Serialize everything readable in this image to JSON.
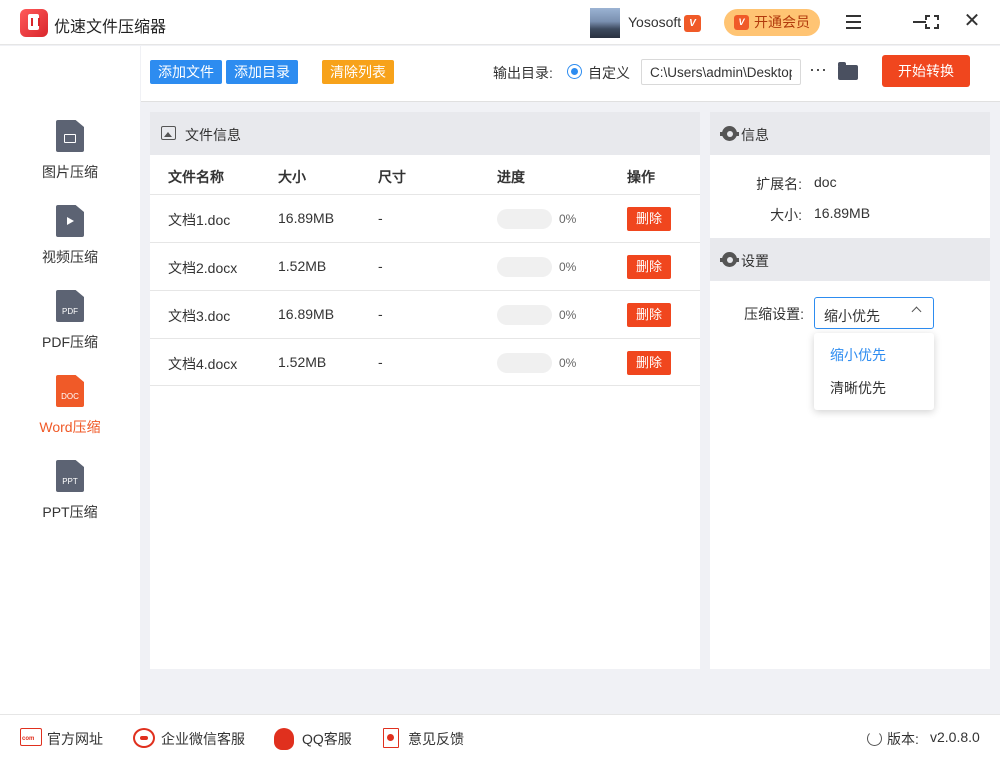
{
  "app": {
    "title": "优速文件压缩器",
    "username": "Yososoft",
    "user_badge": "V",
    "vip_button": "开通会员",
    "vip_icon": "V"
  },
  "sidebar": {
    "items": [
      {
        "label": "图片压缩",
        "icon": "image-file-icon",
        "icon_text": ""
      },
      {
        "label": "视频压缩",
        "icon": "video-file-icon",
        "icon_text": ""
      },
      {
        "label": "PDF压缩",
        "icon": "pdf-file-icon",
        "icon_text": "PDF"
      },
      {
        "label": "Word压缩",
        "icon": "doc-file-icon",
        "icon_text": "DOC",
        "active": true
      },
      {
        "label": "PPT压缩",
        "icon": "ppt-file-icon",
        "icon_text": "PPT"
      }
    ]
  },
  "toolbar": {
    "add_file": "添加文件",
    "add_dir": "添加目录",
    "clear_list": "清除列表",
    "output_label": "输出目录:",
    "custom_label": "自定义",
    "output_path": "C:\\Users\\admin\\Desktop",
    "more": "···",
    "start": "开始转换"
  },
  "file_panel": {
    "title": "文件信息",
    "columns": [
      "文件名称",
      "大小",
      "尺寸",
      "进度",
      "操作"
    ],
    "rows": [
      {
        "name": "文档1.doc",
        "size": "16.89MB",
        "dim": "-",
        "progress": 0,
        "progress_text": "0%",
        "action": "删除"
      },
      {
        "name": "文档2.docx",
        "size": "1.52MB",
        "dim": "-",
        "progress": 0,
        "progress_text": "0%",
        "action": "删除"
      },
      {
        "name": "文档3.doc",
        "size": "16.89MB",
        "dim": "-",
        "progress": 0,
        "progress_text": "0%",
        "action": "删除"
      },
      {
        "name": "文档4.docx",
        "size": "1.52MB",
        "dim": "-",
        "progress": 0,
        "progress_text": "0%",
        "action": "删除"
      }
    ]
  },
  "info_panel": {
    "title": "信息",
    "ext_label": "扩展名:",
    "ext_value": "doc",
    "size_label": "大小:",
    "size_value": "16.89MB"
  },
  "settings_panel": {
    "title": "设置",
    "compress_label": "压缩设置:",
    "selected": "缩小优先",
    "options": [
      "缩小优先",
      "清晰优先"
    ]
  },
  "footer": {
    "website": "官方网址",
    "website_icon_text": "com",
    "wechat": "企业微信客服",
    "qq": "QQ客服",
    "feedback": "意见反馈",
    "version_label": "版本:",
    "version": "v2.0.8.0"
  },
  "colors": {
    "accent": "#2d8cf0",
    "danger": "#f0461e",
    "active": "#f05a28",
    "warn": "#f7a21a"
  }
}
